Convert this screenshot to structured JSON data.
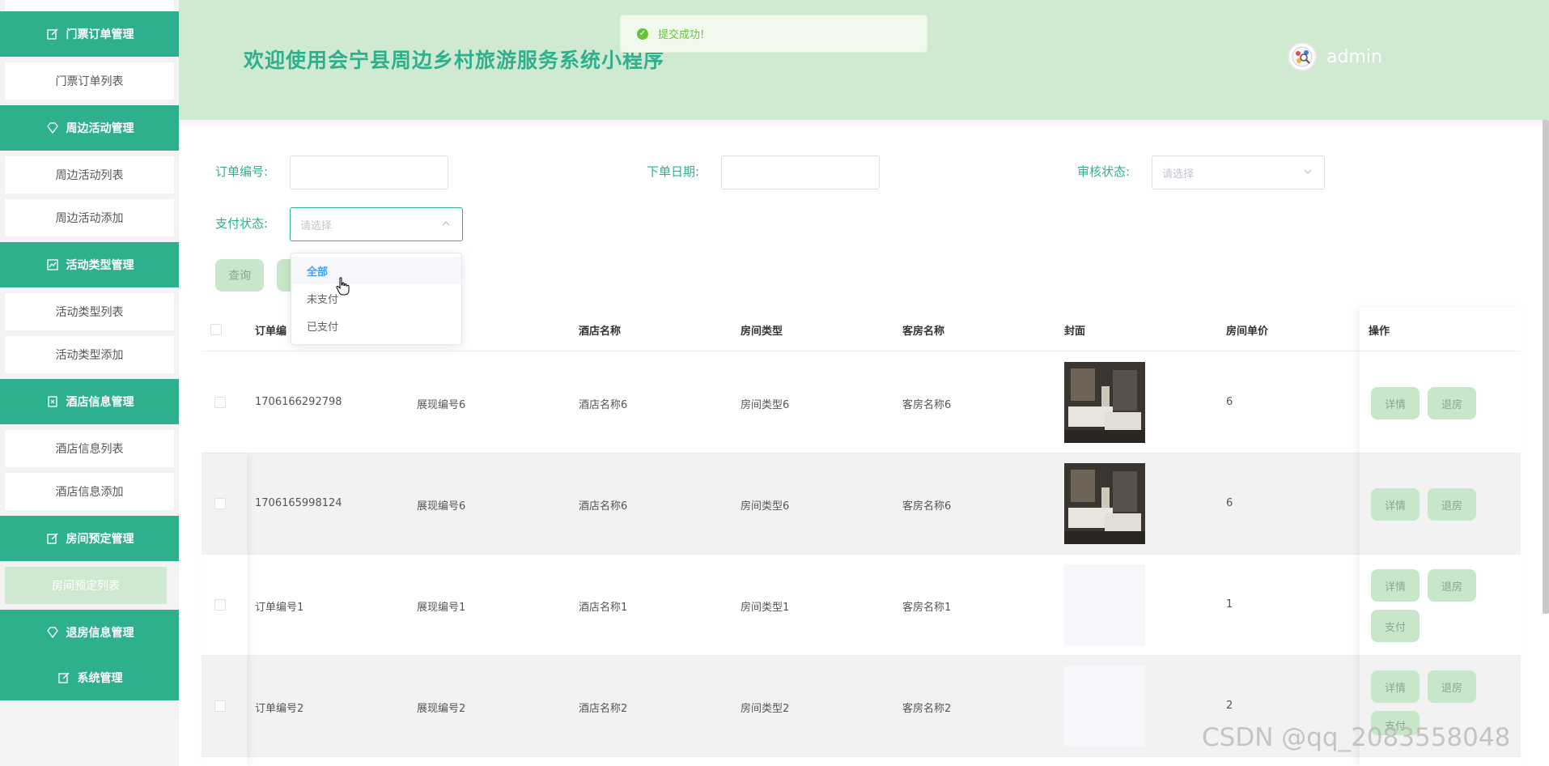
{
  "sidebar": {
    "groups": [
      {
        "label": "门票订单管理",
        "icon": "edit-icon",
        "items": [
          "门票订单列表"
        ]
      },
      {
        "label": "周边活动管理",
        "icon": "diamond-icon",
        "items": [
          "周边活动列表",
          "周边活动添加"
        ]
      },
      {
        "label": "活动类型管理",
        "icon": "chart-icon",
        "items": [
          "活动类型列表",
          "活动类型添加"
        ]
      },
      {
        "label": "酒店信息管理",
        "icon": "hotel-icon",
        "items": [
          "酒店信息列表",
          "酒店信息添加"
        ]
      },
      {
        "label": "房间预定管理",
        "icon": "edit-icon",
        "items": [
          "房间预定列表"
        ]
      },
      {
        "label": "退房信息管理",
        "icon": "diamond-icon",
        "items": []
      },
      {
        "label": "系统管理",
        "icon": "edit-icon",
        "items": []
      }
    ],
    "active_item": "房间预定列表"
  },
  "header": {
    "title": "欢迎使用会宁县周边乡村旅游服务系统小程序",
    "username": "admin"
  },
  "toast": {
    "text": "提交成功!",
    "type": "success"
  },
  "filters": {
    "order_no_label": "订单编号:",
    "order_date_label": "下单日期:",
    "audit_status_label": "审核状态:",
    "audit_status_placeholder": "请选择",
    "pay_status_label": "支付状态:",
    "pay_status_placeholder": "请选择",
    "search_label": "查询"
  },
  "pay_dropdown": {
    "options": [
      "全部",
      "未支付",
      "已支付"
    ],
    "highlighted": "全部"
  },
  "table": {
    "columns": [
      "订单编",
      "",
      "酒店名称",
      "房间类型",
      "客房名称",
      "封面",
      "房间单价",
      "操作"
    ],
    "rows": [
      {
        "order_no": "1706166292798",
        "show_no": "展现编号6",
        "hotel": "酒店名称6",
        "room_type": "房间类型6",
        "room_name": "客房名称6",
        "cover": "hotel-room-photo",
        "price": "6",
        "actions": [
          "详情",
          "退房"
        ]
      },
      {
        "order_no": "1706165998124",
        "show_no": "展现编号6",
        "hotel": "酒店名称6",
        "room_type": "房间类型6",
        "room_name": "客房名称6",
        "cover": "hotel-room-photo",
        "price": "6",
        "actions": [
          "详情",
          "退房"
        ]
      },
      {
        "order_no": "订单编号1",
        "show_no": "展现编号1",
        "hotel": "酒店名称1",
        "room_type": "房间类型1",
        "room_name": "客房名称1",
        "cover": "",
        "price": "1",
        "actions": [
          "详情",
          "退房",
          "支付"
        ]
      },
      {
        "order_no": "订单编号2",
        "show_no": "展现编号2",
        "hotel": "酒店名称2",
        "room_type": "房间类型2",
        "room_name": "客房名称2",
        "cover": "",
        "price": "2",
        "actions": [
          "详情",
          "退房",
          "支付"
        ]
      }
    ]
  },
  "watermark": "CSDN @qq_2083558048",
  "colors": {
    "primary": "#2eb08f",
    "header_bg": "#d0ead1",
    "button_bg": "#c8e6c9",
    "success": "#67c23a"
  }
}
